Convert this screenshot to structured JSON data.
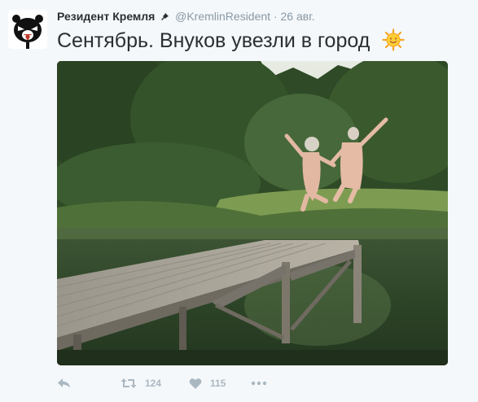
{
  "author": {
    "name": "Резидент Кремля",
    "handle": "@KremlinResident",
    "separator": "·",
    "time": "26 авг."
  },
  "tweet": {
    "text": "Сентябрь. Внуков увезли в город",
    "emoji_icon": "sun-face-icon"
  },
  "actions": {
    "reply_icon": "reply-icon",
    "retweet_icon": "retweet-icon",
    "retweets": "124",
    "like_icon": "heart-icon",
    "likes": "115",
    "more_icon": "more-dots-icon"
  },
  "colors": {
    "background": "#f5f8fa",
    "text": "#292f33",
    "muted": "#8899a6",
    "action": "#aab8c2"
  }
}
